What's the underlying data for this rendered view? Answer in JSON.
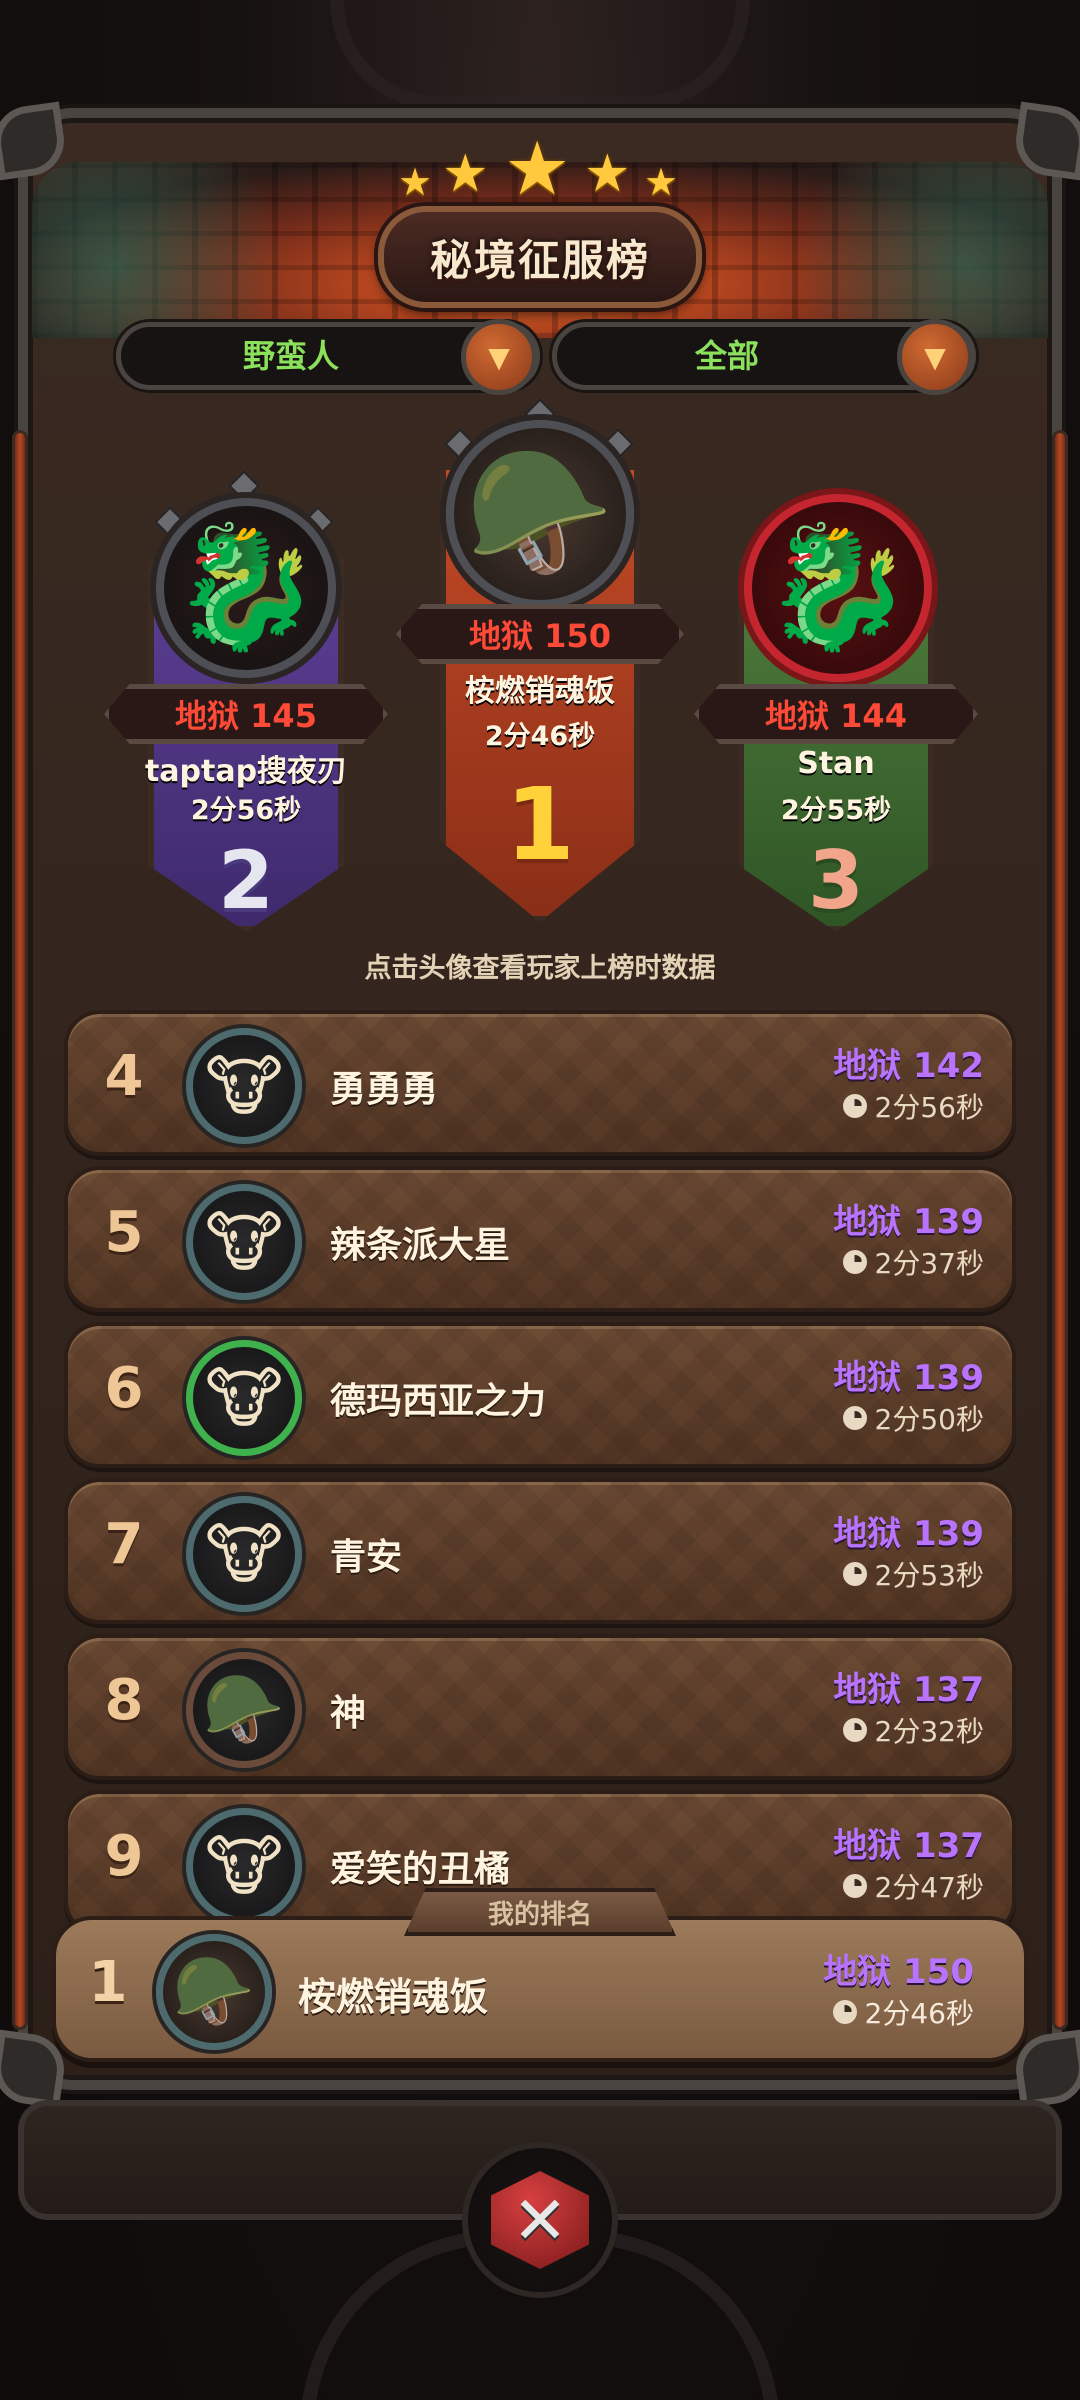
{
  "title": "秘境征服榜",
  "filters": {
    "class_label": "野蛮人",
    "scope_label": "全部"
  },
  "podium": [
    {
      "rank": "2",
      "level": "地狱 145",
      "name": "taptap搜夜刃",
      "time": "2分56秒",
      "avatar_icon": "red-dragon-icon"
    },
    {
      "rank": "1",
      "level": "地狱 150",
      "name": "桉燃销魂饭",
      "time": "2分46秒",
      "avatar_icon": "viking-helmet-icon"
    },
    {
      "rank": "3",
      "level": "地狱 144",
      "name": "Stan",
      "time": "2分55秒",
      "avatar_icon": "red-dragon-icon"
    }
  ],
  "hint": "点击头像查看玩家上榜时数据",
  "rows": [
    {
      "rank": "4",
      "name": "勇勇勇",
      "level": "地狱 142",
      "time": "2分56秒"
    },
    {
      "rank": "5",
      "name": "辣条派大星",
      "level": "地狱 139",
      "time": "2分37秒"
    },
    {
      "rank": "6",
      "name": "德玛西亚之力",
      "level": "地狱 139",
      "time": "2分50秒"
    },
    {
      "rank": "7",
      "name": "青安",
      "level": "地狱 139",
      "time": "2分53秒"
    },
    {
      "rank": "8",
      "name": "神",
      "level": "地狱 137",
      "time": "2分32秒"
    },
    {
      "rank": "9",
      "name": "爱笑的丑橘",
      "level": "地狱 137",
      "time": "2分47秒"
    }
  ],
  "my_rank": {
    "label": "我的排名",
    "rank": "1",
    "name": "桉燃销魂饭",
    "level": "地狱 150",
    "time": "2分46秒"
  },
  "colors": {
    "level_purple": "#b873ff",
    "podium_level_red": "#ff4a38",
    "filter_green": "#8be05c"
  }
}
